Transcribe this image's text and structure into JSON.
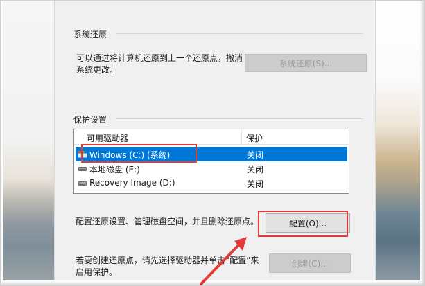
{
  "system_restore": {
    "group_title": "系统还原",
    "description_line1": "可以通过将计算机还原到上一个还原点，撤消",
    "description_line2": "系统更改。",
    "button_label": "系统还原(S)..."
  },
  "protection": {
    "group_title": "保护设置",
    "columns": [
      "可用驱动器",
      "保护"
    ],
    "drives": [
      {
        "name": "Windows (C:) (系统)",
        "protection": "关闭",
        "icon": "system-drive-icon",
        "selected": true
      },
      {
        "name": "本地磁盘 (E:)",
        "protection": "关闭",
        "icon": "drive-icon",
        "selected": false
      },
      {
        "name": "Recovery Image (D:)",
        "protection": "关闭",
        "icon": "drive-icon",
        "selected": false
      }
    ],
    "configure_text": "配置还原设置、管理磁盘空间，并且删除还原点。",
    "configure_button": "配置(O)...",
    "create_text_line1": "若要创建还原点，请先选择驱动器并单击“配置”来",
    "create_text_line2": "启用保护。",
    "create_button": "创建(C)..."
  },
  "colors": {
    "selection": "#0078d7",
    "highlight": "#e33b3b",
    "dialog_bg": "#f0f0f0"
  }
}
